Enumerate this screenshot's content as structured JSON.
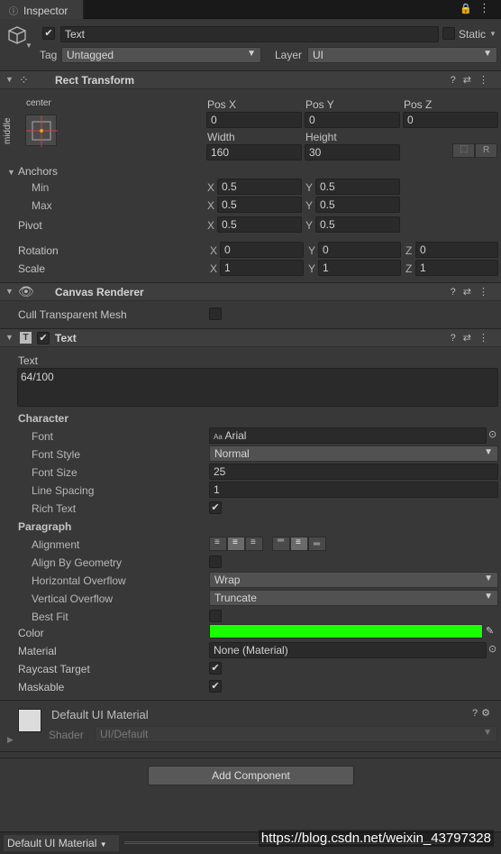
{
  "tab": {
    "title": "Inspector"
  },
  "object": {
    "name": "Text",
    "static_label": "Static",
    "tag_label": "Tag",
    "tag_value": "Untagged",
    "layer_label": "Layer",
    "layer_value": "UI"
  },
  "rect_transform": {
    "title": "Rect Transform",
    "anchor_h": "center",
    "anchor_v": "middle",
    "pos_x_label": "Pos X",
    "pos_y_label": "Pos Y",
    "pos_z_label": "Pos Z",
    "pos_x": "0",
    "pos_y": "0",
    "pos_z": "0",
    "width_label": "Width",
    "height_label": "Height",
    "width": "160",
    "height": "30",
    "r_label": "R",
    "anchors_label": "Anchors",
    "min_label": "Min",
    "max_label": "Max",
    "min_x": "0.5",
    "min_y": "0.5",
    "max_x": "0.5",
    "max_y": "0.5",
    "pivot_label": "Pivot",
    "pivot_x": "0.5",
    "pivot_y": "0.5",
    "rotation_label": "Rotation",
    "rot_x": "0",
    "rot_y": "0",
    "rot_z": "0",
    "scale_label": "Scale",
    "scale_x": "1",
    "scale_y": "1",
    "scale_z": "1",
    "x": "X",
    "y": "Y",
    "z": "Z"
  },
  "canvas_renderer": {
    "title": "Canvas Renderer",
    "cull_label": "Cull Transparent Mesh"
  },
  "text_component": {
    "title": "Text",
    "text_label": "Text",
    "text_value": "64/100",
    "character_label": "Character",
    "font_label": "Font",
    "font_value": "Arial",
    "font_prefix": "Aa",
    "font_style_label": "Font Style",
    "font_style_value": "Normal",
    "font_size_label": "Font Size",
    "font_size_value": "25",
    "line_spacing_label": "Line Spacing",
    "line_spacing_value": "1",
    "rich_text_label": "Rich Text",
    "paragraph_label": "Paragraph",
    "alignment_label": "Alignment",
    "align_geometry_label": "Align By Geometry",
    "h_overflow_label": "Horizontal Overflow",
    "h_overflow_value": "Wrap",
    "v_overflow_label": "Vertical Overflow",
    "v_overflow_value": "Truncate",
    "best_fit_label": "Best Fit",
    "color_label": "Color",
    "color_value": "#19ff00",
    "material_label": "Material",
    "material_value": "None (Material)",
    "raycast_label": "Raycast Target",
    "maskable_label": "Maskable"
  },
  "material_section": {
    "name": "Default UI Material",
    "shader_label": "Shader",
    "shader_value": "UI/Default"
  },
  "add_component": "Add Component",
  "footer": {
    "dropdown": "Default UI Material"
  },
  "watermark": "https://blog.csdn.net/weixin_43797328"
}
